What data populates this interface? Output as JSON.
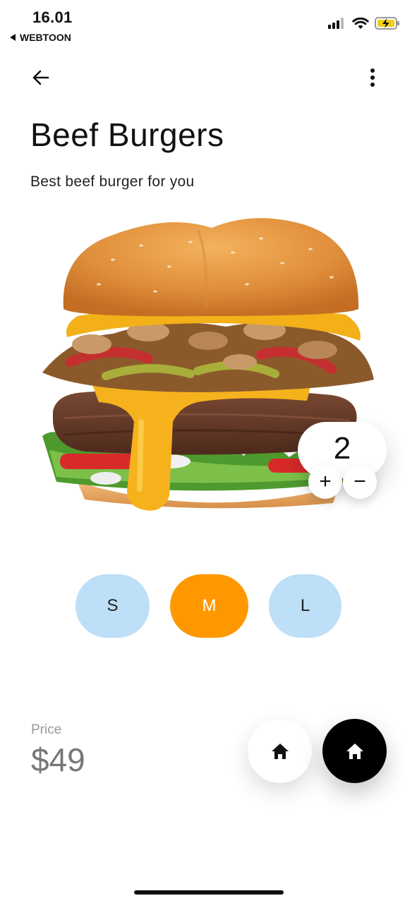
{
  "status_bar": {
    "time": "16.01",
    "back_app": "WEBTOON",
    "icons": [
      "signal-icon",
      "wifi-icon",
      "battery-charging-icon"
    ]
  },
  "header": {
    "back_icon": "arrow-left-icon",
    "more_icon": "more-vertical-icon"
  },
  "product": {
    "title": "Beef Burgers",
    "subtitle": "Best beef burger for you",
    "image": "beef-burger-image"
  },
  "quantity": {
    "value": "2",
    "plus_label": "+",
    "minus_label": "−"
  },
  "sizes": {
    "options": [
      "S",
      "M",
      "L"
    ],
    "selected": "M"
  },
  "price": {
    "label": "Price",
    "value": "$49"
  },
  "actions": {
    "primary_icon": "home-icon",
    "secondary_icon": "home-icon"
  },
  "colors": {
    "accent": "#ff9800",
    "size_unselected": "#bddff7",
    "fab_dark": "#000000"
  }
}
